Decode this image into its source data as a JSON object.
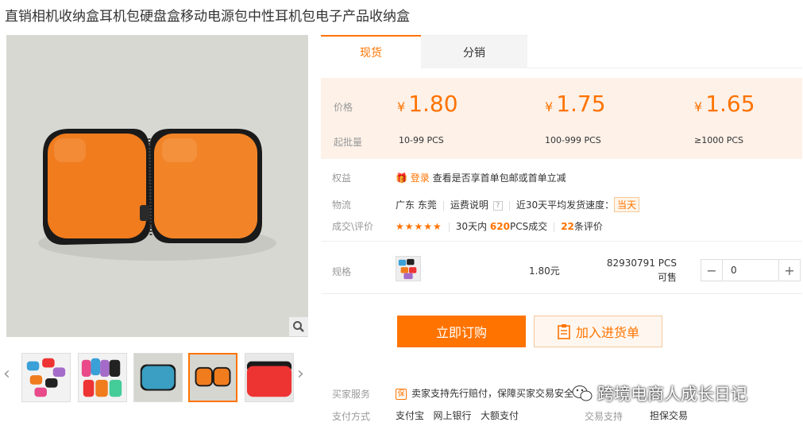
{
  "title": "直销相机收纳盒耳机包硬盘盒移动电源包中性耳机包电子产品收纳盒",
  "tabs": [
    {
      "label": "现货",
      "active": true
    },
    {
      "label": "分销",
      "active": false
    }
  ],
  "price": {
    "price_label": "价格",
    "moq_label": "起批量",
    "currency": "¥",
    "tiers": [
      {
        "price": "1.80",
        "range": "10-99  PCS"
      },
      {
        "price": "1.75",
        "range": "100-999  PCS"
      },
      {
        "price": "1.65",
        "range": "≥1000  PCS"
      }
    ]
  },
  "benefits": {
    "label": "权益",
    "login": "登录",
    "text": "查看是否享首单包邮或首单立减"
  },
  "logistics": {
    "label": "物流",
    "location": "广东 东莞",
    "shipping_info": "运费说明",
    "speed_text": "近30天平均发货速度：",
    "speed_value": "当天"
  },
  "reviews": {
    "label": "成交\\评价",
    "stars": "★★★★★",
    "deals_prefix": "30天内",
    "deals_count": "620",
    "deals_suffix": "PCS成交",
    "review_count": "22",
    "review_suffix": "条评价"
  },
  "spec": {
    "label": "规格",
    "price": "1.80元",
    "stock": "82930791 PCS可售",
    "quantity": "0",
    "minus": "−",
    "plus": "+"
  },
  "actions": {
    "buy": "立即订购",
    "cart": "加入进货单"
  },
  "service": {
    "label": "买家服务",
    "badge": "保",
    "text": "卖家支持先行赔付，保障买家交易安全"
  },
  "payment": {
    "label": "支付方式",
    "methods": [
      "支付宝",
      "网上银行",
      "大额支付"
    ],
    "trade_label": "交易支持",
    "trade_value": "担保交易"
  },
  "watermark": "跨境电商人成长日记",
  "colors": {
    "accent": "#ff7300",
    "price_bg": "#fdf1e8",
    "product_orange": "#f07c1e"
  },
  "icons": {
    "zoom": "magnifier-icon",
    "prev": "chevron-left-icon",
    "next": "chevron-right-icon",
    "cart": "clipboard-icon",
    "guarantee": "shield-icon"
  }
}
